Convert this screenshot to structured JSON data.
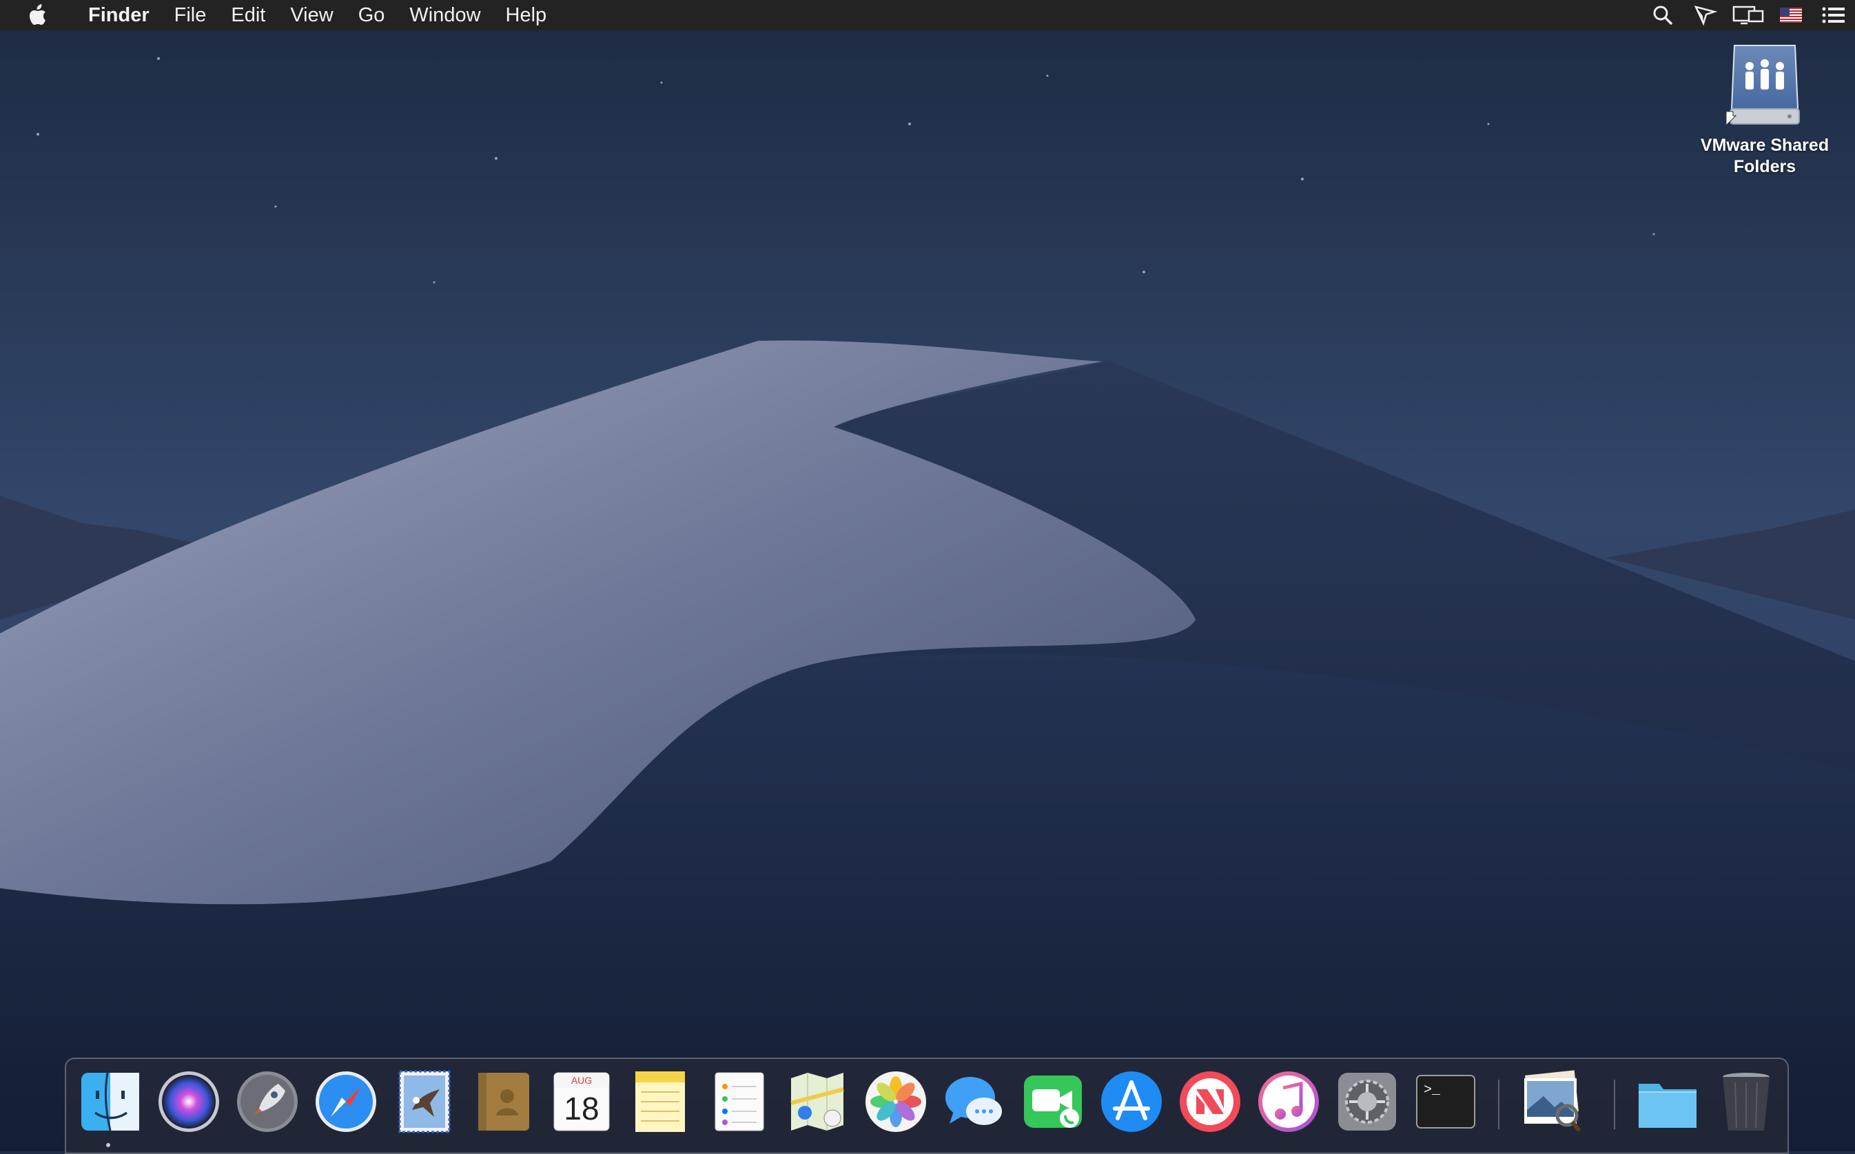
{
  "menubar": {
    "apple_icon": "apple-logo-icon",
    "app_name": "Finder",
    "menus": [
      "File",
      "Edit",
      "View",
      "Go",
      "Window",
      "Help"
    ],
    "status_icons": [
      "spotlight-search-icon",
      "airplay-cursor-icon",
      "display-mirroring-icon",
      "us-flag-input-icon",
      "notification-center-icon"
    ]
  },
  "desktop": {
    "icons": [
      {
        "label_line1": "VMware Shared",
        "label_line2": "Folders",
        "icon": "shared-folders-drive-icon"
      }
    ]
  },
  "dock": {
    "apps": [
      "Finder",
      "Siri",
      "Launchpad",
      "Safari",
      "Mail",
      "Contacts",
      "Calendar",
      "Notes",
      "Reminders",
      "Maps",
      "Photos",
      "Messages",
      "FaceTime",
      "App Store",
      "News",
      "iTunes",
      "System Preferences",
      "Terminal",
      "Preview",
      "Downloads",
      "Trash"
    ],
    "calendar": {
      "month": "AUG",
      "day": "18"
    },
    "terminal_prompt": ">_",
    "running_indicator": "Finder"
  },
  "colors": {
    "menubar_bg": "#232324",
    "sky_top": "#1f2d46",
    "dune_light": "#8b93b0",
    "dune_shadow": "#1e2a46"
  }
}
